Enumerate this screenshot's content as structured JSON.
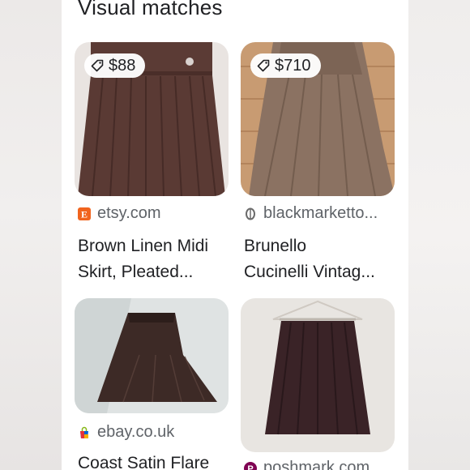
{
  "section_title": "Visual matches",
  "results": [
    {
      "price": "$88",
      "site": "etsy.com",
      "title_line1": "Brown Linen Midi",
      "title_line2": "Skirt, Pleated..."
    },
    {
      "price": "$710",
      "site": "blackmarketto...",
      "title_line1": "Brunello",
      "title_line2": "Cucinelli Vintag..."
    },
    {
      "site": "ebay.co.uk",
      "title_line1": "Coast Satin Flare"
    },
    {
      "site": "poshmark.com"
    }
  ],
  "colors": {
    "etsy_orange": "#f1641e",
    "ebay_red": "#e53238",
    "ebay_blue": "#0064d2",
    "ebay_yellow": "#f5af02",
    "poshmark_maroon": "#7f0353",
    "skirt_brown": "#5a3a34"
  },
  "icons": [
    "price-tag-icon",
    "etsy-favicon",
    "blackmarket-favicon",
    "ebay-favicon",
    "poshmark-favicon"
  ]
}
